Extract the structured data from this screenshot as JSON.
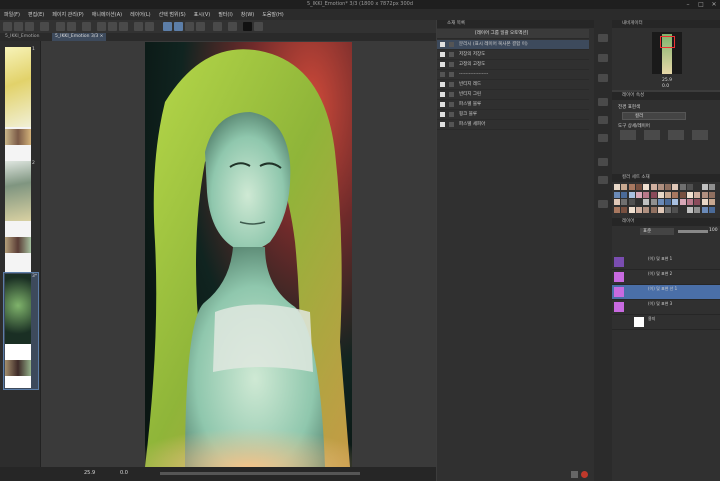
{
  "window": {
    "title": "5_IKKI_Emotion* 3/3 (1800 x 7872px 300d",
    "min": "–",
    "max": "□",
    "close": "✕"
  },
  "menu": [
    "파일(F)",
    "편집(E)",
    "페이지 관리(P)",
    "애니메이션(A)",
    "레이어(L)",
    "선택 범위(S)",
    "표시(V)",
    "필터(I)",
    "창(W)",
    "도움말(H)"
  ],
  "document_tab": {
    "label": "5_IKKI_Emotion 3/3",
    "close": "×"
  },
  "page_tab": {
    "label": "5_IKKI_Emotion"
  },
  "pages": [
    {
      "number": "1"
    },
    {
      "number": "2"
    },
    {
      "number": "3*"
    }
  ],
  "status": {
    "zoom": "25.9",
    "angle": "0.0"
  },
  "materials": {
    "title": "소재 목록",
    "rows": [
      {
        "label": "[레이어 그룹 일괄 오토액션]",
        "checked": false
      },
      {
        "label": "분리시 (표시 레이어 복사본 결합 이)",
        "checked": true
      },
      {
        "label": "저장의 저장도",
        "checked": true
      },
      {
        "label": "고정의 고정도",
        "checked": true
      },
      {
        "label": "------------------",
        "checked": false
      },
      {
        "label": "빈티지 레드",
        "checked": true
      },
      {
        "label": "빈티지 그린",
        "checked": true
      },
      {
        "label": "파스텔 블루",
        "checked": true
      },
      {
        "label": "핑크 블루",
        "checked": true
      },
      {
        "label": "파스텔 세피아",
        "checked": true
      }
    ]
  },
  "navigator": {
    "title": "내비게이터",
    "zoom": "25.9",
    "angle": "0.0"
  },
  "layer_props": {
    "title": "레이어 속성",
    "effect_label": "전경 표현색",
    "color_select": "컬러",
    "tool_label": "도구 상세/레이어"
  },
  "color_set": {
    "title": "컬러 세트 소재"
  },
  "layers": {
    "title": "레이어",
    "blend_mode": "표준",
    "opacity": "100",
    "items": [
      {
        "name": "(이) 및 표현\n1",
        "color": "#7a4db0",
        "kind": "folder"
      },
      {
        "name": "(이) 및 표현\n2",
        "color": "#c86ae0",
        "kind": "folder"
      },
      {
        "name": "(이) 및 표현\n선 1",
        "color": "#4a6fa8",
        "kind": "layer"
      },
      {
        "name": "(이) 및 표현\n3",
        "color": "#c86ae0",
        "kind": "folder"
      },
      {
        "name": "용지",
        "color": "#ffffff",
        "kind": "paper"
      }
    ]
  },
  "colors": {
    "accent": "#5c7ea8",
    "selection": "#4a6fa8"
  }
}
